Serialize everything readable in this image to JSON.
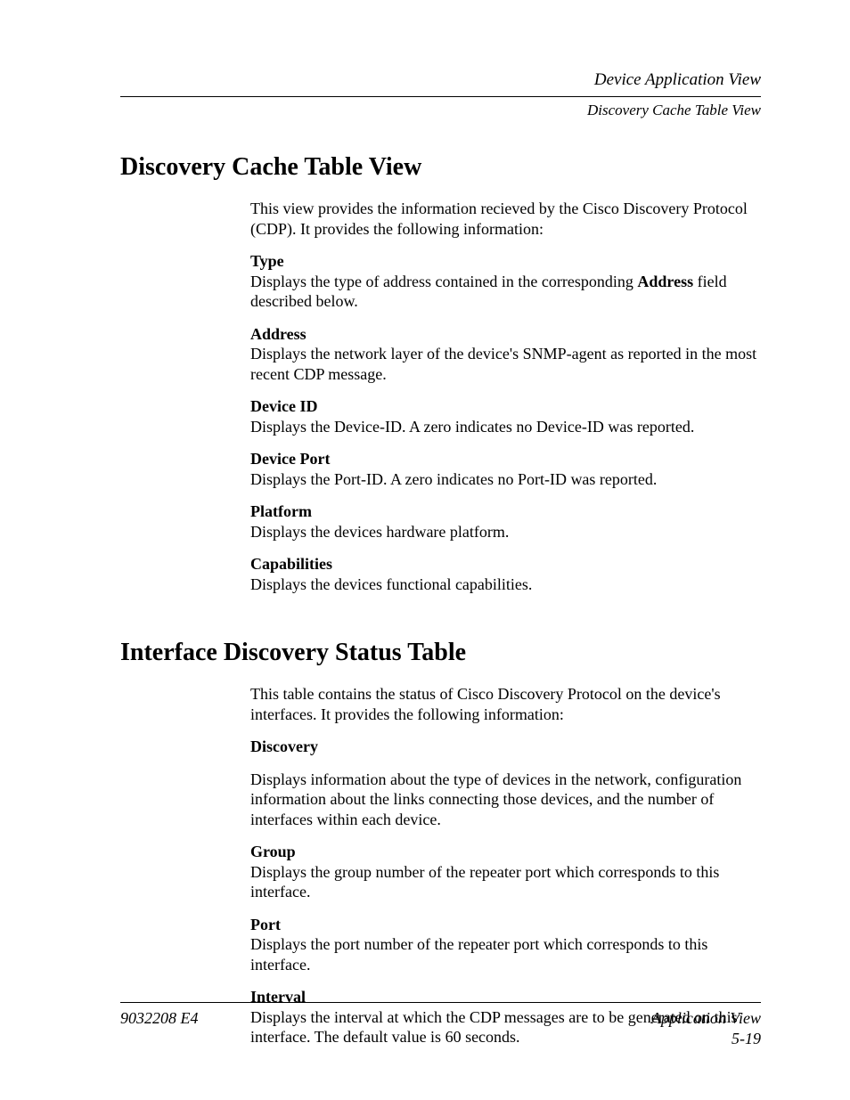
{
  "header": {
    "line1": "Device Application View",
    "line2": "Discovery Cache Table View"
  },
  "sections": [
    {
      "title": "Discovery Cache Table View",
      "intro_parts": [
        "This view provides the information recieved by the Cisco Discovery Protocol (CDP). It provides the following information:"
      ],
      "fields": [
        {
          "label": "Type",
          "body_pre": "Displays the type of address contained in the corresponding ",
          "body_bold": "Address",
          "body_post": " field described below."
        },
        {
          "label": "Address",
          "body": "Displays the network layer of the device's SNMP-agent as reported in the most recent CDP message."
        },
        {
          "label": "Device ID",
          "body": "Displays the Device-ID. A zero indicates no Device-ID was reported."
        },
        {
          "label": "Device Port",
          "body": "Displays the Port-ID. A zero indicates no Port-ID was reported."
        },
        {
          "label": "Platform",
          "body": "Displays the devices hardware platform."
        },
        {
          "label": "Capabilities",
          "body": "Displays the devices functional capabilities."
        }
      ]
    },
    {
      "title": "Interface Discovery Status Table",
      "intro_parts": [
        "This table contains the status of Cisco Discovery Protocol on the device's interfaces. It provides the following information:"
      ],
      "fields": [
        {
          "label": "Discovery",
          "gap_after_label": true,
          "body": "Displays information about the type of devices in the network, configuration information about the links connecting those devices, and the number of interfaces within each device."
        },
        {
          "label": "Group",
          "body": "Displays the group number of the repeater port which corresponds to this interface."
        },
        {
          "label": "Port",
          "body": "Displays the port number of the repeater port which corresponds to this interface."
        },
        {
          "label": "Interval",
          "body": "Displays the interval at which the CDP messages are to be generated on this interface. The default value is 60 seconds."
        }
      ]
    }
  ],
  "footer": {
    "left": "9032208 E4",
    "right_line1": "Application View",
    "right_line2": "5-19"
  }
}
